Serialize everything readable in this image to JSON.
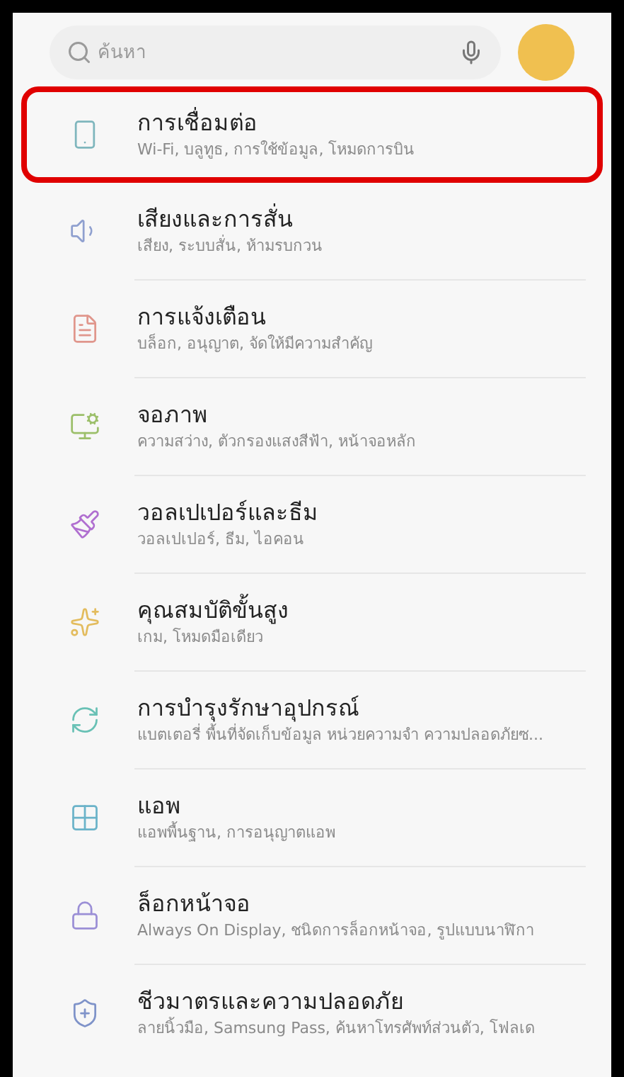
{
  "search": {
    "placeholder": "ค้นหา"
  },
  "items": [
    {
      "title": "การเชื่อมต่อ",
      "subtitle": "Wi-Fi, บลูทูธ, การใช้ข้อมูล, โหมดการบิน",
      "highlighted": true
    },
    {
      "title": "เสียงและการสั่น",
      "subtitle": "เสียง, ระบบสั่น, ห้ามรบกวน",
      "highlighted": false
    },
    {
      "title": "การแจ้งเตือน",
      "subtitle": "บล็อก, อนุญาต, จัดให้มีความสำคัญ",
      "highlighted": false
    },
    {
      "title": "จอภาพ",
      "subtitle": "ความสว่าง, ตัวกรองแสงสีฟ้า, หน้าจอหลัก",
      "highlighted": false
    },
    {
      "title": "วอลเปเปอร์และธีม",
      "subtitle": "วอลเปเปอร์, ธีม, ไอคอน",
      "highlighted": false
    },
    {
      "title": "คุณสมบัติขั้นสูง",
      "subtitle": "เกม, โหมดมือเดียว",
      "highlighted": false
    },
    {
      "title": "การบำรุงรักษาอุปกรณ์",
      "subtitle": "แบตเตอรี่ พื้นที่จัดเก็บข้อมูล หน่วยความจำ ความปลอดภัยซ...",
      "highlighted": false
    },
    {
      "title": "แอพ",
      "subtitle": "แอพพื้นฐาน, การอนุญาตแอพ",
      "highlighted": false
    },
    {
      "title": "ล็อกหน้าจอ",
      "subtitle": "Always On Display, ชนิดการล็อกหน้าจอ, รูปแบบนาฬิกา",
      "highlighted": false
    },
    {
      "title": "ชีวมาตรและความปลอดภัย",
      "subtitle": "ลายนิ้วมือ, Samsung Pass, ค้นหาโทรศัพท์ส่วนตัว, โฟลเด",
      "highlighted": false
    }
  ]
}
